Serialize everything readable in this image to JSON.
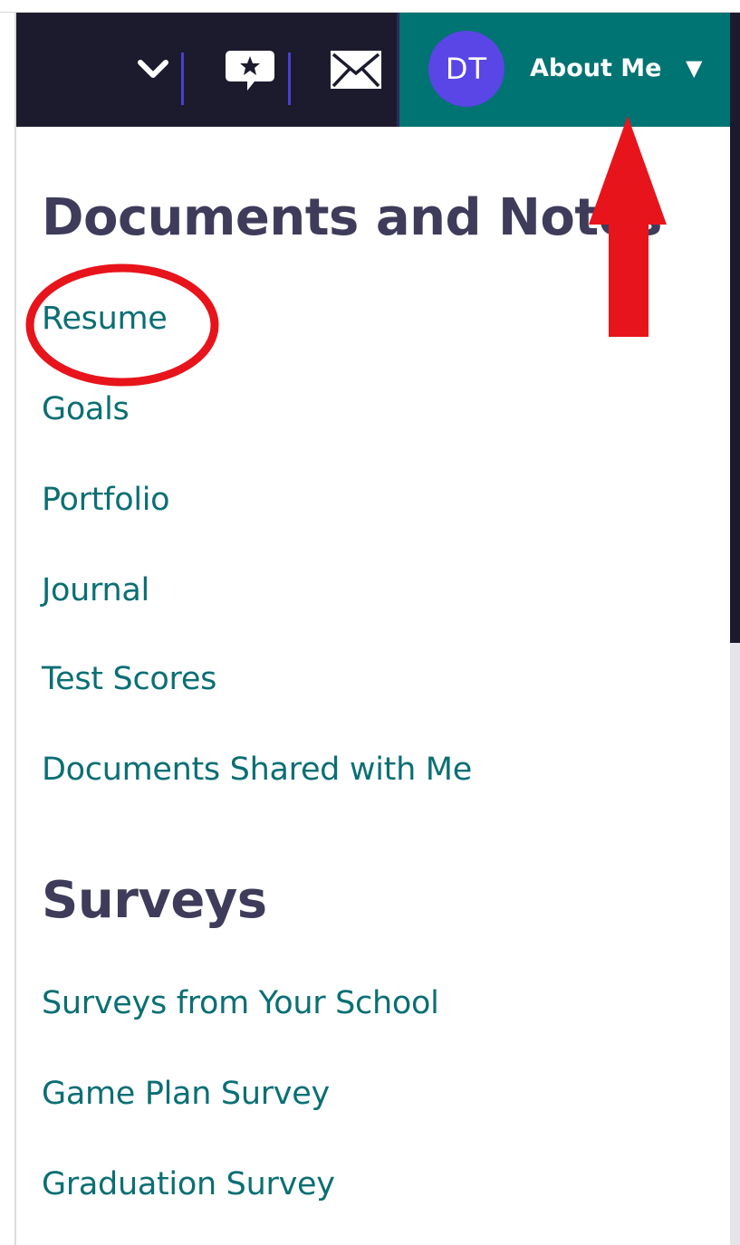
{
  "topbar": {
    "chevron_icon": "chevron-down-icon",
    "chat_icon": "chat-star-icon",
    "mail_icon": "envelope-icon",
    "avatar_initials": "DT",
    "about_label": "About Me",
    "about_caret": "▼",
    "colors": {
      "bar": "#1c1b2e",
      "about_bg": "#007373",
      "avatar": "#5a45e6",
      "divider": "#4b3fd1"
    }
  },
  "menu": {
    "sections": [
      {
        "title": "Documents and Notes",
        "items": [
          "Resume",
          "Goals",
          "Portfolio",
          "Journal",
          "Test Scores",
          "Documents Shared with Me"
        ]
      },
      {
        "title": "Surveys",
        "items": [
          "Surveys from Your School",
          "Game Plan Survey",
          "Graduation Survey"
        ]
      }
    ],
    "colors": {
      "heading": "#3e3c5a",
      "link": "#0b6f74"
    }
  },
  "annotations": {
    "circle_target": "Resume",
    "arrow_target": "About Me",
    "color": "#e8141c"
  }
}
